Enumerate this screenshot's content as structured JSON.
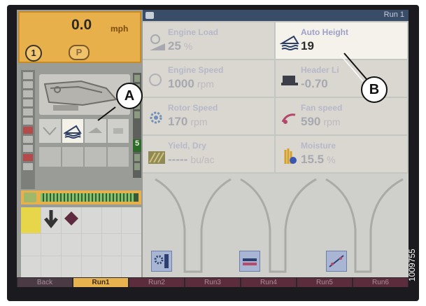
{
  "status": {
    "speed_value": "0.0",
    "speed_unit": "mph",
    "gear": "1",
    "park": "P",
    "run_label": "Run 1"
  },
  "tiles": [
    {
      "label": "Engine Load",
      "value": "25",
      "unit": "%",
      "icon": "engine-load-icon"
    },
    {
      "label": "Auto Height",
      "value": "19",
      "unit": "",
      "icon": "auto-height-icon",
      "highlighted": true
    },
    {
      "label": "Engine Speed",
      "value": "1000",
      "unit": "rpm",
      "icon": "engine-speed-icon"
    },
    {
      "label": "Header Li",
      "value": "-0.70",
      "unit": "",
      "icon": "header-lift-icon"
    },
    {
      "label": "Rotor Speed",
      "value": "170",
      "unit": "rpm",
      "icon": "rotor-speed-icon"
    },
    {
      "label": "Fan speed",
      "value": "590",
      "unit": "rpm",
      "icon": "fan-speed-icon"
    },
    {
      "label": "Yield, Dry",
      "value": "-----",
      "unit": "bu/ac",
      "icon": "yield-icon"
    },
    {
      "label": "Moisture",
      "value": "15.5",
      "unit": "%",
      "icon": "moisture-icon"
    }
  ],
  "progress": {
    "fill_fraction": 0.95
  },
  "tabs": [
    "Back",
    "Run1",
    "Run2",
    "Run3",
    "Run4",
    "Run5",
    "Run6"
  ],
  "selected_tab": "Run1",
  "callouts": {
    "a": "A",
    "b": "B"
  },
  "figure_id": "1009755",
  "colors": {
    "speed_panel": "#e7b04a",
    "selected_tab": "#e8b24e",
    "topbar": "#394c68",
    "tab_inactive": "#5b2d3c"
  }
}
